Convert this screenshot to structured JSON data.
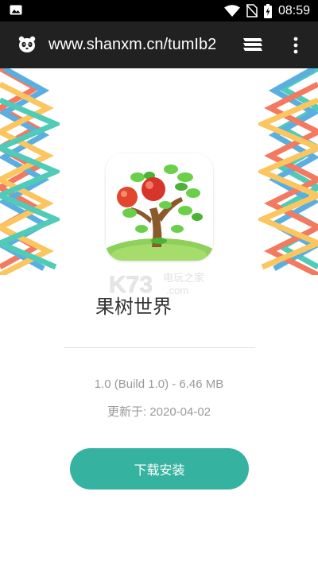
{
  "status_bar": {
    "time": "08:59",
    "icons": [
      "image-icon",
      "wifi-icon",
      "no-sim-icon",
      "battery-charging-icon"
    ]
  },
  "toolbar": {
    "url": "www.shanxm.cn/tumIb2",
    "favicon": "panda-icon",
    "tabs_icon": "tabs-icon",
    "menu_icon": "more-vert-icon"
  },
  "app": {
    "name": "果树世界",
    "icon": "fruit-tree-app-icon",
    "version_info": "1.0 (Build 1.0) - 6.46 MB",
    "update_date": "更新于: 2020-04-02",
    "download_label": "下载安装"
  },
  "watermark": {
    "logo": "K73",
    "text": "电玩之家",
    "domain": ".com"
  },
  "colors": {
    "accent": "#36b3a0",
    "toolbar": "#212121",
    "statusbar": "#000000"
  }
}
